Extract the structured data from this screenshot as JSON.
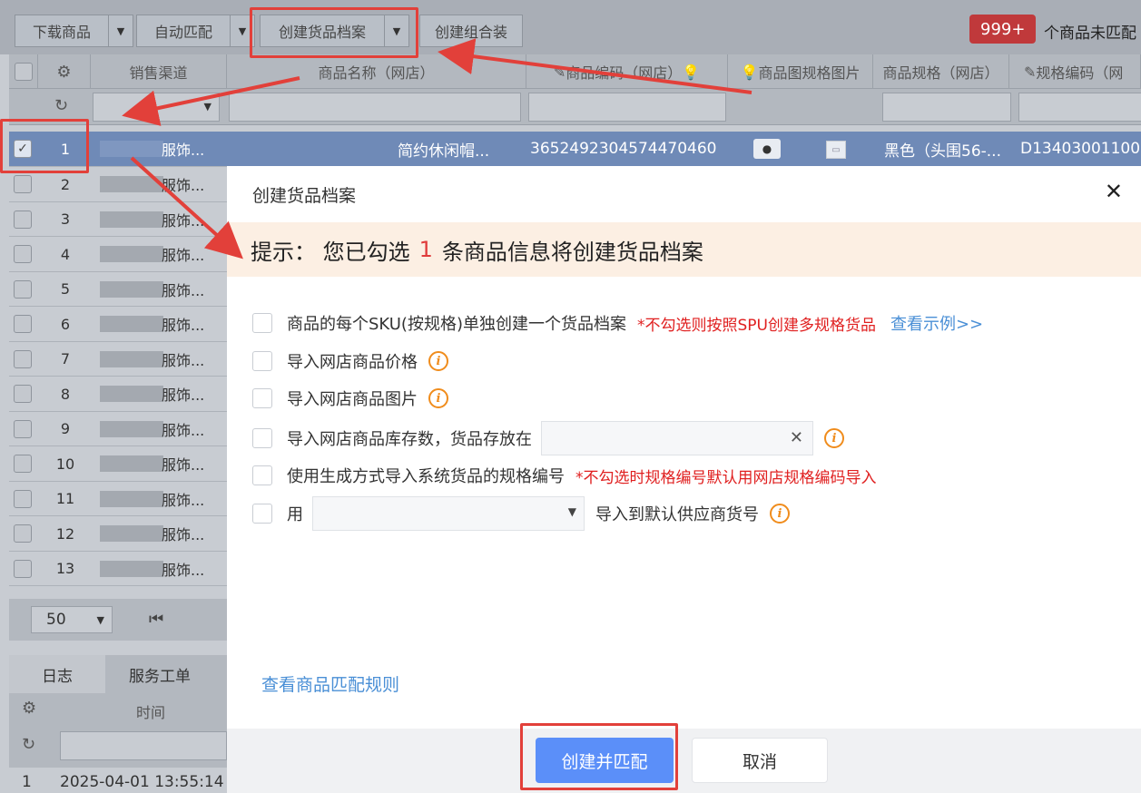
{
  "toolbar": {
    "download_label": "下载商品",
    "auto_match_label": "自动匹配",
    "create_archive_label": "创建货品档案",
    "create_combo_label": "创建组合装",
    "unmatched_badge": "999+",
    "unmatched_text": "个商品未匹配"
  },
  "grid": {
    "headers": {
      "channel": "销售渠道",
      "product_name": "商品名称（网店）",
      "product_code": "商品编码（网店）",
      "image": "商品图",
      "spec_image": "规格图片",
      "spec": "商品规格（网店）",
      "spec_code": "规格编码（网"
    },
    "selected_row": {
      "num": "1",
      "channel": "服饰...",
      "name": "简约休闲帽...",
      "code": "3652492304574470460",
      "spec": "黑色（头围56-...",
      "spec_code": "D13403001100"
    },
    "rows": [
      {
        "num": "2",
        "channel": "服饰..."
      },
      {
        "num": "3",
        "channel": "服饰..."
      },
      {
        "num": "4",
        "channel": "服饰..."
      },
      {
        "num": "5",
        "channel": "服饰..."
      },
      {
        "num": "6",
        "channel": "服饰..."
      },
      {
        "num": "7",
        "channel": "服饰..."
      },
      {
        "num": "8",
        "channel": "服饰..."
      },
      {
        "num": "9",
        "channel": "服饰..."
      },
      {
        "num": "10",
        "channel": "服饰..."
      },
      {
        "num": "11",
        "channel": "服饰..."
      },
      {
        "num": "12",
        "channel": "服饰..."
      },
      {
        "num": "13",
        "channel": "服饰..."
      }
    ],
    "page_size": "50"
  },
  "bottom": {
    "tab_log": "日志",
    "tab_ticket": "服务工单",
    "time_header": "时间",
    "log_row_num": "1",
    "log_row_time": "2025-04-01 13:55:14"
  },
  "modal": {
    "title": "创建货品档案",
    "tip_prefix": "提示：  您已勾选",
    "tip_count": "1",
    "tip_suffix": "条商品信息将创建货品档案",
    "opt1_label": "商品的每个SKU(按规格)单独创建一个货品档案",
    "opt1_note": "*不勾选则按照SPU创建多规格货品",
    "opt1_link": "查看示例>>",
    "opt2_label": "导入网店商品价格",
    "opt3_label": "导入网店商品图片",
    "opt4_label": "导入网店商品库存数，货品存放在",
    "opt5_label": "使用生成方式导入系统货品的规格编号",
    "opt5_note": "*不勾选时规格编号默认用网店规格编码导入",
    "opt6_prefix": "用",
    "opt6_suffix": "导入到默认供应商货号",
    "rules_link": "查看商品匹配规则",
    "confirm_label": "创建并匹配",
    "cancel_label": "取消"
  },
  "colors": {
    "primary": "#5b8ff9",
    "annotation_red": "#e2403a",
    "tip_bg": "#fcefe3",
    "badge_red": "#c0393b"
  }
}
